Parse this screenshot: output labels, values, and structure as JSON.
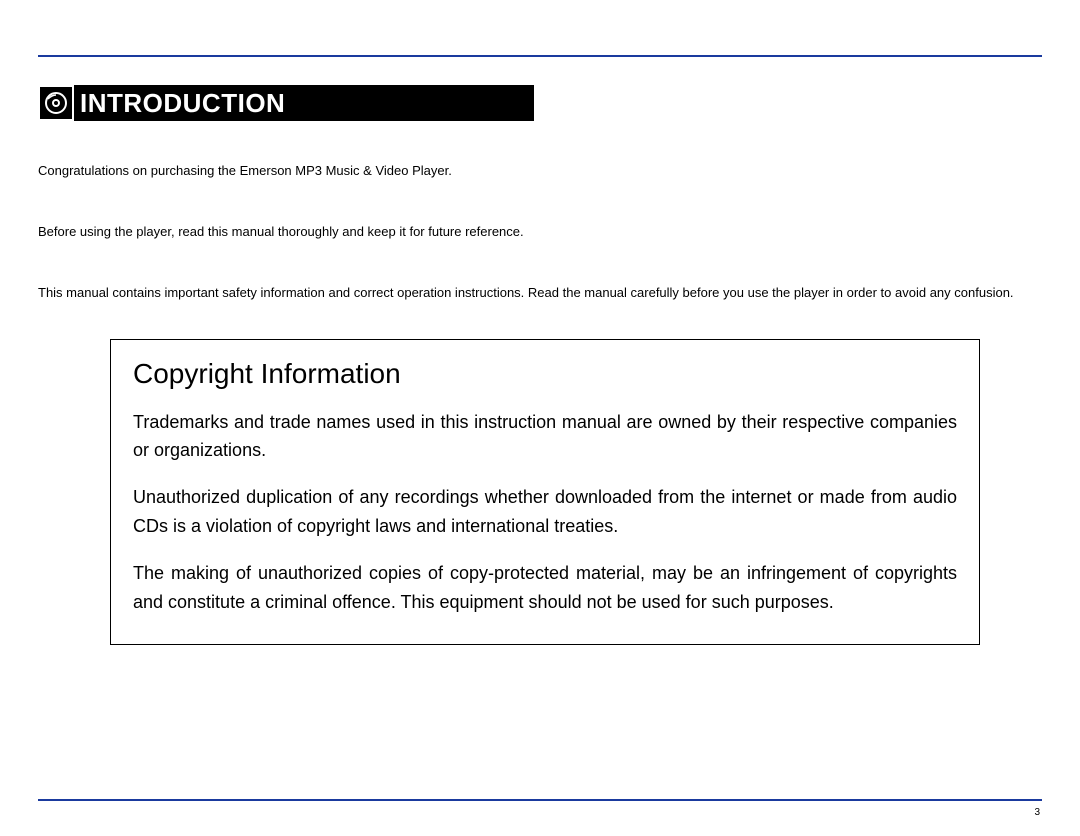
{
  "section_title": "INTRODUCTION",
  "intro": {
    "p1": "Congratulations on purchasing the Emerson MP3 Music & Video Player.",
    "p2": "Before using the player, read this manual thoroughly and keep it for future reference.",
    "p3": "This manual contains important safety information and correct operation instructions.  Read the manual carefully before you use the player in order to avoid any confusion."
  },
  "copyright": {
    "title": "Copyright Information",
    "p1": "Trademarks and trade names used in this instruction manual are owned by their respective companies or organizations.",
    "p2": "Unauthorized duplication of any recordings whether downloaded from the internet or made from audio CDs is a violation of copyright laws and international treaties.",
    "p3": "The making of unauthorized copies of copy-protected material, may be an infringement of copyrights and constitute a criminal offence. This equipment should not be used for such purposes."
  },
  "page_number": "3",
  "colors": {
    "rule": "#1a3a9e"
  }
}
